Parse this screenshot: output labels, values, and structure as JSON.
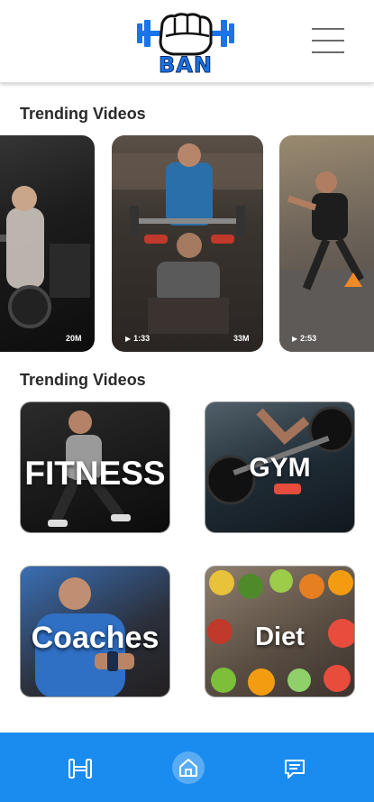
{
  "header": {
    "logo_text": "BAN",
    "menu_icon": "hamburger-menu-icon"
  },
  "sections": {
    "videos_title": "Trending Videos",
    "categories_title": "Trending Videos"
  },
  "videos": [
    {
      "views": "20M",
      "duration": ""
    },
    {
      "views": "33M",
      "duration": "1:33"
    },
    {
      "views": "",
      "duration": "2:53"
    }
  ],
  "categories": [
    {
      "label": "FITNESS"
    },
    {
      "label": "GYM"
    },
    {
      "label": "Coaches"
    },
    {
      "label": "Diet"
    }
  ],
  "bottom_nav": {
    "items": [
      {
        "icon": "dumbbell-icon"
      },
      {
        "icon": "home-icon",
        "active": true
      },
      {
        "icon": "chat-icon"
      }
    ],
    "color": "#1a8cf0"
  },
  "colors": {
    "brand_blue": "#1a73e8",
    "nav_blue": "#1a8cf0"
  }
}
